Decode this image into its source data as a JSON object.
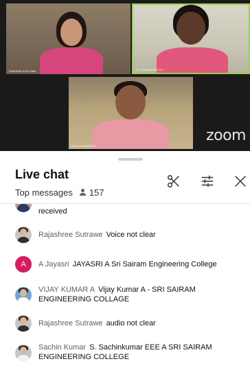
{
  "video": {
    "participants": [
      {
        "name": "SWARNA KCG MBA"
      },
      {
        "name": "K V DAVARIYA KCG"
      },
      {
        "name": "SIVA CHANDRA S"
      }
    ],
    "logo": "zoom"
  },
  "chat": {
    "title": "Live chat",
    "mode": "Top messages",
    "viewer_count": "157",
    "icons": {
      "viewer": "person-icon",
      "clip": "scissors-icon",
      "settings": "sliders-icon",
      "close": "close-icon"
    },
    "messages": [
      {
        "author": "",
        "text": "received"
      },
      {
        "author": "Rajashree Sutrawe",
        "text": "Voice not clear"
      },
      {
        "author": "A Jayasri",
        "text": "JAYASRI A Sri Sairam Engineering College",
        "avatar_letter": "A"
      },
      {
        "author": "VIJAY KUMAR A",
        "text": "Vijay Kumar A - SRI SAIRAM ENGINEERING COLLAGE"
      },
      {
        "author": "Rajashree Sutrawe",
        "text": "audio not clear"
      },
      {
        "author": "Sachin Kumar",
        "text": "S. Sachinkumar EEE A SRI SAIRAM ENGINEERING COLLEGE"
      }
    ]
  },
  "colors": {
    "active_speaker_border": "#9ad14b",
    "letter_avatar": "#d81b60"
  }
}
